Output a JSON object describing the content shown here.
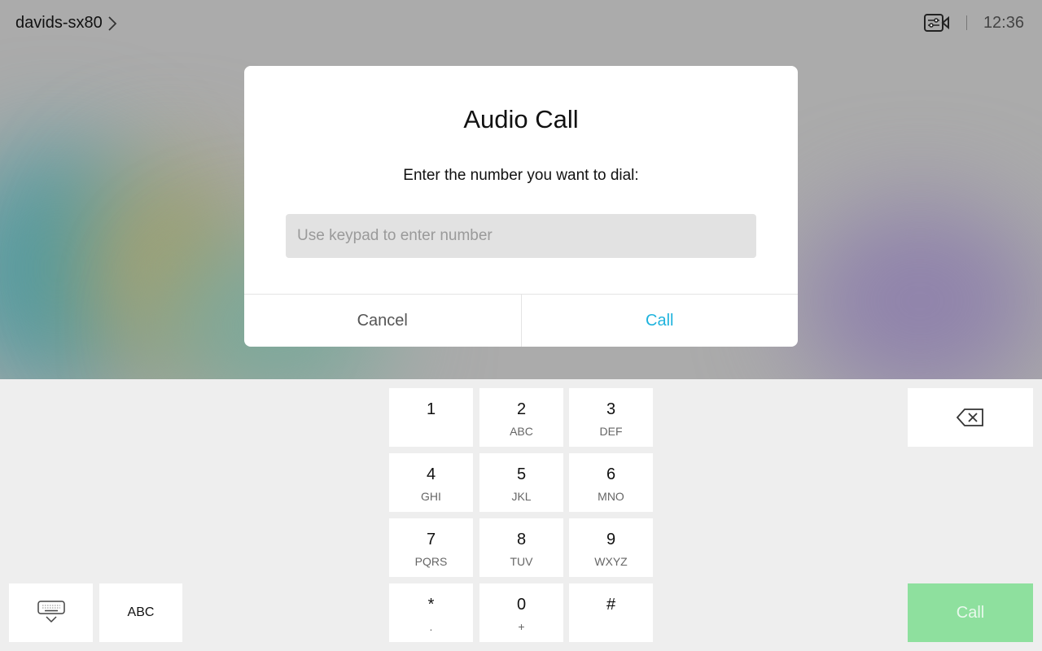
{
  "header": {
    "device_name": "davids-sx80",
    "time": "12:36",
    "camera_control_icon": "camera-settings-icon"
  },
  "dialog": {
    "title": "Audio Call",
    "prompt": "Enter the number you want to dial:",
    "input_placeholder": "Use keypad to enter number",
    "input_value": "",
    "cancel_label": "Cancel",
    "call_label": "Call"
  },
  "keypad": {
    "keys": [
      {
        "digit": "1",
        "letters": ""
      },
      {
        "digit": "2",
        "letters": "ABC"
      },
      {
        "digit": "3",
        "letters": "DEF"
      },
      {
        "digit": "4",
        "letters": "GHI"
      },
      {
        "digit": "5",
        "letters": "JKL"
      },
      {
        "digit": "6",
        "letters": "MNO"
      },
      {
        "digit": "7",
        "letters": "PQRS"
      },
      {
        "digit": "8",
        "letters": "TUV"
      },
      {
        "digit": "9",
        "letters": "WXYZ"
      },
      {
        "digit": "*",
        "letters": "."
      },
      {
        "digit": "0",
        "letters": "+"
      },
      {
        "digit": "#",
        "letters": ""
      }
    ]
  },
  "bottom": {
    "abc_label": "ABC",
    "call_label": "Call",
    "call_color": "#8ee09e",
    "accent": "#1fb3dd"
  }
}
